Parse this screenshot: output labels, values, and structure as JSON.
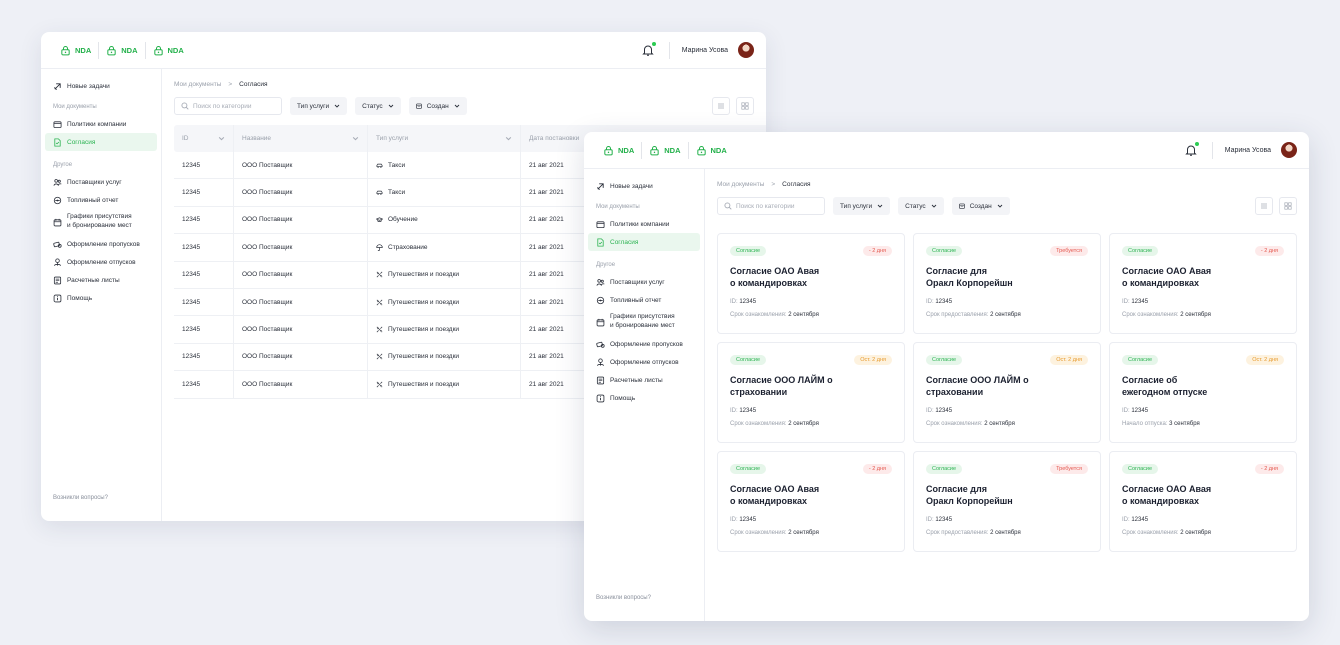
{
  "header": {
    "nda_tabs": [
      "NDA",
      "NDA",
      "NDA"
    ],
    "user_name": "Марина Усова"
  },
  "sidebar": {
    "new_tasks": "Новые задачи",
    "section_docs": "Мои документы",
    "policies": "Политики компании",
    "consents": "Согласия",
    "section_other": "Другое",
    "items": [
      {
        "label": "Поставщики услуг",
        "icon": "users-icon"
      },
      {
        "label": "Топливный отчет",
        "icon": "fuel-icon"
      },
      {
        "label": "Графики присутствия\nи бронирование мест",
        "icon": "calendar-icon"
      },
      {
        "label": "Оформление пропусков",
        "icon": "pass-icon"
      },
      {
        "label": "Оформление отпусков",
        "icon": "vacation-icon"
      },
      {
        "label": "Расчетные листы",
        "icon": "payslip-icon"
      },
      {
        "label": "Помощь",
        "icon": "help-icon"
      }
    ],
    "bottom": "Возникли вопросы?"
  },
  "breadcrumb": {
    "root": "Мои документы",
    "sep": ">",
    "current": "Согласия"
  },
  "toolbar": {
    "search_placeholder": "Поиск по категории",
    "filter_type": "Тип услуги",
    "filter_status": "Статус",
    "filter_created": "Создан"
  },
  "table": {
    "columns": [
      "ID",
      "Название",
      "Тип услуги",
      "Дата постановки"
    ],
    "rows": [
      {
        "id": "12345",
        "name": "ООО Поставщик",
        "type": "Такси",
        "icon": "car-icon",
        "date": "21 авг 2021"
      },
      {
        "id": "12345",
        "name": "ООО Поставщик",
        "type": "Такси",
        "icon": "car-icon",
        "date": "21 авг 2021"
      },
      {
        "id": "12345",
        "name": "ООО Поставщик",
        "type": "Обучение",
        "icon": "graduation-icon",
        "date": "21 авг 2021"
      },
      {
        "id": "12345",
        "name": "ООО Поставщик",
        "type": "Страхование",
        "icon": "umbrella-icon",
        "date": "21 авг 2021"
      },
      {
        "id": "12345",
        "name": "ООО Поставщик",
        "type": "Путешествия и поездки",
        "icon": "plane-icon",
        "date": "21 авг 2021"
      },
      {
        "id": "12345",
        "name": "ООО Поставщик",
        "type": "Путешествия и поездки",
        "icon": "plane-icon",
        "date": "21 авг 2021"
      },
      {
        "id": "12345",
        "name": "ООО Поставщик",
        "type": "Путешествия и поездки",
        "icon": "plane-icon",
        "date": "21 авг 2021"
      },
      {
        "id": "12345",
        "name": "ООО Поставщик",
        "type": "Путешествия и поездки",
        "icon": "plane-icon",
        "date": "21 авг 2021"
      },
      {
        "id": "12345",
        "name": "ООО Поставщик",
        "type": "Путешествия и поездки",
        "icon": "plane-icon",
        "date": "21 авг 2021"
      }
    ]
  },
  "cards": [
    {
      "badge": "Согласие",
      "status": "- 2 дня",
      "status_color": "red",
      "title": "Согласие ОАО Авая\nо командировках",
      "id_label": "ID:",
      "id": "12345",
      "date_label": "Срок ознакомления:",
      "date": "2 сентября"
    },
    {
      "badge": "Согласие",
      "status": "Требуется",
      "status_color": "red",
      "title": "Согласие для\nОракл Корпорейшн",
      "id_label": "ID:",
      "id": "12345",
      "date_label": "Срок предоставления:",
      "date": "2 сентября"
    },
    {
      "badge": "Согласие",
      "status": "- 2 дня",
      "status_color": "red",
      "title": "Согласие ОАО Авая\nо командировках",
      "id_label": "ID:",
      "id": "12345",
      "date_label": "Срок ознакомления:",
      "date": "2 сентября"
    },
    {
      "badge": "Согласие",
      "status": "Ост. 2 дня",
      "status_color": "orange",
      "title": "Согласие ООО ЛАЙМ о\nстраховании",
      "id_label": "ID:",
      "id": "12345",
      "date_label": "Срок ознакомления:",
      "date": "2 сентября"
    },
    {
      "badge": "Согласие",
      "status": "Ост. 2 дня",
      "status_color": "orange",
      "title": "Согласие ООО ЛАЙМ о\nстраховании",
      "id_label": "ID:",
      "id": "12345",
      "date_label": "Срок ознакомления:",
      "date": "2 сентября"
    },
    {
      "badge": "Согласие",
      "status": "Ост. 2 дня",
      "status_color": "orange",
      "title": "Согласие об\nежегодном отпуске",
      "id_label": "ID:",
      "id": "12345",
      "date_label": "Начало отпуска:",
      "date": "3 сентября"
    },
    {
      "badge": "Согласие",
      "status": "- 2 дня",
      "status_color": "red",
      "title": "Согласие ОАО Авая\nо командировках",
      "id_label": "ID:",
      "id": "12345",
      "date_label": "Срок ознакомления:",
      "date": "2 сентября"
    },
    {
      "badge": "Согласие",
      "status": "Требуется",
      "status_color": "red",
      "title": "Согласие для\nОракл Корпорейшн",
      "id_label": "ID:",
      "id": "12345",
      "date_label": "Срок предоставления:",
      "date": "2 сентября"
    },
    {
      "badge": "Согласие",
      "status": "- 2 дня",
      "status_color": "red",
      "title": "Согласие ОАО Авая\nо командировках",
      "id_label": "ID:",
      "id": "12345",
      "date_label": "Срок ознакомления:",
      "date": "2 сентября"
    }
  ],
  "colors": {
    "accent": "#2db453",
    "danger": "#e4574e",
    "warning": "#e79a2c"
  }
}
